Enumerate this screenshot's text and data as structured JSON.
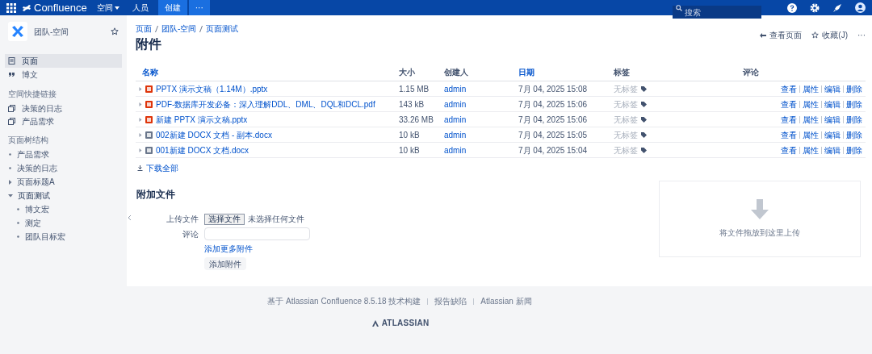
{
  "top_nav": {
    "app_name": "Confluence",
    "items": [
      {
        "label": "空间",
        "dropdown": true
      },
      {
        "label": "人员",
        "dropdown": false
      }
    ],
    "create_button": "创建",
    "more_button": "···",
    "search": {
      "placeholder": "搜索"
    }
  },
  "sidebar": {
    "space_name": "团队-空间",
    "nav": [
      {
        "label": "页面",
        "selected": true
      },
      {
        "label": "博文",
        "selected": false
      }
    ],
    "shortcuts_title": "空间快捷链接",
    "shortcuts": [
      "决策的日志",
      "产品需求"
    ],
    "tree_title": "页面树结构",
    "tree": [
      {
        "label": "产品需求",
        "kind": "leaf"
      },
      {
        "label": "决策的日志",
        "kind": "leaf"
      },
      {
        "label": "页面标题A",
        "kind": "collapsed"
      },
      {
        "label": "页面测试",
        "kind": "expanded",
        "children": [
          {
            "label": "博文宏",
            "kind": "leaf"
          },
          {
            "label": "测定",
            "kind": "leaf"
          },
          {
            "label": "团队目标宏",
            "kind": "leaf"
          }
        ]
      }
    ]
  },
  "breadcrumbs": [
    "页面",
    "团队-空间",
    "页面测试"
  ],
  "page_actions": [
    "查看页面",
    "收藏(J)",
    "···"
  ],
  "title": "附件",
  "table": {
    "columns": [
      {
        "label": "名称",
        "link": true
      },
      {
        "label": "大小",
        "link": false
      },
      {
        "label": "创建人",
        "link": false
      },
      {
        "label": "日期",
        "link": true
      },
      {
        "label": "标签",
        "link": false
      },
      {
        "label": "评论",
        "link": false
      }
    ],
    "rows": [
      {
        "kind": "pptx",
        "name": "PPTX 演示文稿（1.14M）.pptx",
        "size": "1.15 MB",
        "creator": "admin",
        "date": "7月 04, 2025 15:08",
        "labels": "无标签",
        "actions": [
          "查看",
          "属性",
          "编辑",
          "删除"
        ]
      },
      {
        "kind": "pdf",
        "name": "PDF-数据库开发必备：深入理解DDL、DML、DQL和DCL.pdf",
        "size": "143 kB",
        "creator": "admin",
        "date": "7月 04, 2025 15:06",
        "labels": "无标签",
        "actions": [
          "查看",
          "属性",
          "编辑",
          "删除"
        ]
      },
      {
        "kind": "pptx",
        "name": "新建 PPTX 演示文稿.pptx",
        "size": "33.26 MB",
        "creator": "admin",
        "date": "7月 04, 2025 15:06",
        "labels": "无标签",
        "actions": [
          "查看",
          "属性",
          "编辑",
          "删除"
        ]
      },
      {
        "kind": "docx",
        "name": "002新建 DOCX 文档 - 副本.docx",
        "size": "10 kB",
        "creator": "admin",
        "date": "7月 04, 2025 15:05",
        "labels": "无标签",
        "actions": [
          "查看",
          "属性",
          "编辑",
          "删除"
        ]
      },
      {
        "kind": "docx",
        "name": "001新建 DOCX 文档.docx",
        "size": "10 kB",
        "creator": "admin",
        "date": "7月 04, 2025 15:04",
        "labels": "无标签",
        "actions": [
          "查看",
          "属性",
          "编辑",
          "删除"
        ]
      }
    ]
  },
  "download_all": "下载全部",
  "attach": {
    "title": "附加文件",
    "upload_label": "上传文件",
    "choose_button": "选择文件",
    "no_file": "未选择任何文件",
    "comment_label": "评论",
    "add_more": "添加更多附件",
    "submit": "添加附件",
    "drop_zone": "将文件拖放到这里上传"
  },
  "footer": {
    "links": [
      "基于 Atlassian Confluence 8.5.18 技术构建",
      "报告缺陷",
      "Atlassian 新闻"
    ],
    "logo": "ATLASSIAN"
  }
}
